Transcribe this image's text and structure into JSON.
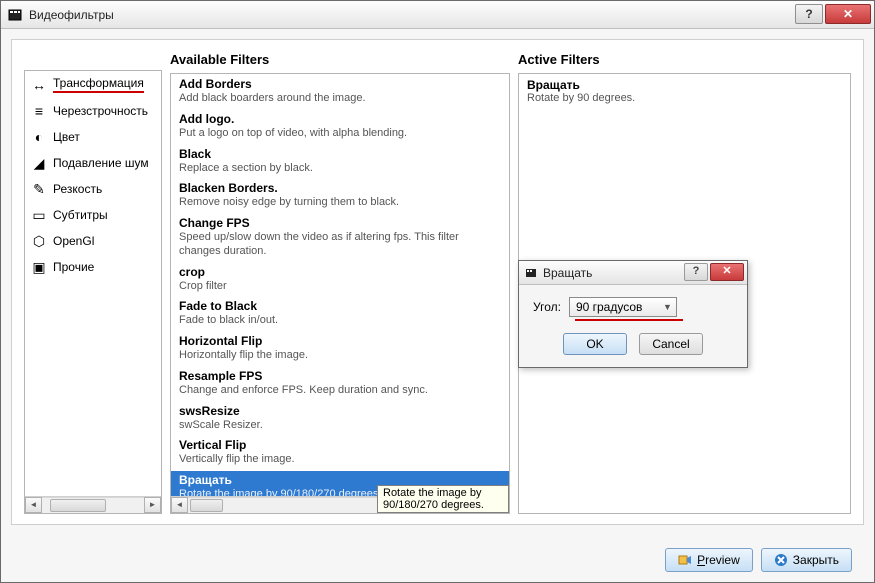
{
  "title": "Видеофильтры",
  "sections": {
    "available_title": "Available Filters",
    "active_title": "Active Filters"
  },
  "categories": [
    {
      "icon": "↔",
      "label": "Трансформация",
      "selected": true
    },
    {
      "icon": "≡",
      "label": "Черезстрочность"
    },
    {
      "icon": "◐",
      "label": "Цвет"
    },
    {
      "icon": "◢",
      "label": "Подавление шум"
    },
    {
      "icon": "✎",
      "label": "Резкость"
    },
    {
      "icon": "▭",
      "label": "Субтитры"
    },
    {
      "icon": "⬡",
      "label": "OpenGl"
    },
    {
      "icon": "▣",
      "label": "Прочие"
    }
  ],
  "available_filters": [
    {
      "name": "Add Borders",
      "desc": "Add black boarders around the image."
    },
    {
      "name": "Add logo.",
      "desc": "Put a logo on top of video, with alpha blending."
    },
    {
      "name": "Black",
      "desc": "Replace a section by black."
    },
    {
      "name": "Blacken Borders.",
      "desc": "Remove noisy edge by turning them to black."
    },
    {
      "name": "Change FPS",
      "desc": "Speed up/slow down the video as if altering fps. This filter changes duration."
    },
    {
      "name": "crop",
      "desc": "Crop filter"
    },
    {
      "name": "Fade to Black",
      "desc": "Fade to black in/out."
    },
    {
      "name": "Horizontal Flip",
      "desc": "Horizontally flip the image."
    },
    {
      "name": "Resample FPS",
      "desc": "Change and enforce FPS. Keep duration and sync."
    },
    {
      "name": "swsResize",
      "desc": "swScale Resizer."
    },
    {
      "name": "Vertical Flip",
      "desc": "Vertically flip the image."
    },
    {
      "name": "Вращать",
      "desc": "Rotate the image by 90/180/270 degrees.",
      "selected": true
    }
  ],
  "tooltip": "Rotate the image by 90/180/270 degrees.",
  "active_filters": [
    {
      "name": "Вращать",
      "desc": "Rotate by 90 degrees."
    }
  ],
  "subdialog": {
    "title": "Вращать",
    "angle_label": "Угол:",
    "angle_value": "90 градусов",
    "ok": "OK",
    "cancel": "Cancel"
  },
  "buttons": {
    "preview": "Preview",
    "close": "Закрыть"
  }
}
